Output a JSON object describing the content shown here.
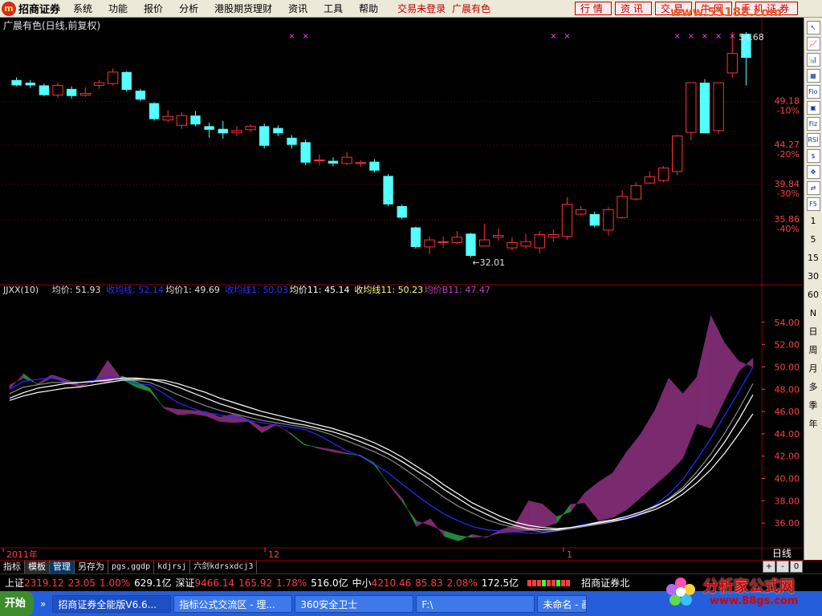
{
  "menubar": {
    "logo": "招商证券",
    "items": [
      "系统",
      "功能",
      "报价",
      "分析",
      "港股期货理财",
      "资讯",
      "工具",
      "帮助"
    ],
    "status": "交易未登录",
    "symbol": "广晨有色",
    "buttons": [
      "行情",
      "资讯",
      "交易",
      "牛网",
      "手机证券"
    ],
    "watermark": "www.55188.com"
  },
  "chart_title": "广晨有色(日线,前复权)",
  "indicator_legend": [
    {
      "text": "JJXX(10)",
      "color": "#e0e0e0"
    },
    {
      "text": "均价: 51.93",
      "color": "#e0e0e0"
    },
    {
      "text": "收均线: 52.14",
      "color": "#3030ff"
    },
    {
      "text": "均价1: 49.69",
      "color": "#e0e0e0"
    },
    {
      "text": "收均线1: 50.03",
      "color": "#3030ff"
    },
    {
      "text": "均价11: 45.14",
      "color": "#ffffff"
    },
    {
      "text": "收均线11: 50.23",
      "color": "#ffff80"
    },
    {
      "text": "均价B11: 47.47",
      "color": "#c040c0"
    }
  ],
  "chart_data": [
    {
      "type": "candlestick",
      "title": "广晨有色(日线,前复权)",
      "price_range": [
        29.0,
        57.0
      ],
      "y_labels": [
        {
          "price": "49.18",
          "pct": "-10%"
        },
        {
          "price": "44.27",
          "pct": "-20%"
        },
        {
          "price": "39.84",
          "pct": "-30%"
        },
        {
          "price": "35.86",
          "pct": "-40%"
        }
      ],
      "annotations": {
        "low_label": "←32.01",
        "high_label": "54.68"
      },
      "colors": {
        "up": "#ff3232",
        "down": "#54ffff"
      },
      "candles": [
        {
          "o": 51.6,
          "c": 51.0,
          "h": 51.9,
          "l": 50.9
        },
        {
          "o": 51.3,
          "c": 51.0,
          "h": 51.6,
          "l": 50.7
        },
        {
          "o": 51.0,
          "c": 49.9,
          "h": 51.2,
          "l": 49.8
        },
        {
          "o": 49.9,
          "c": 51.0,
          "h": 51.3,
          "l": 49.6
        },
        {
          "o": 50.6,
          "c": 49.8,
          "h": 50.9,
          "l": 49.5
        },
        {
          "o": 49.9,
          "c": 50.1,
          "h": 50.8,
          "l": 49.7
        },
        {
          "o": 51.0,
          "c": 51.3,
          "h": 51.6,
          "l": 50.6
        },
        {
          "o": 51.2,
          "c": 52.5,
          "h": 52.9,
          "l": 51.0
        },
        {
          "o": 52.5,
          "c": 50.5,
          "h": 52.6,
          "l": 50.3
        },
        {
          "o": 50.4,
          "c": 49.4,
          "h": 50.6,
          "l": 49.2
        },
        {
          "o": 49.0,
          "c": 47.2,
          "h": 49.1,
          "l": 47.0
        },
        {
          "o": 47.1,
          "c": 47.5,
          "h": 48.2,
          "l": 46.9
        },
        {
          "o": 46.5,
          "c": 47.6,
          "h": 48.0,
          "l": 46.1
        },
        {
          "o": 47.6,
          "c": 46.6,
          "h": 48.1,
          "l": 46.4
        },
        {
          "o": 46.4,
          "c": 46.0,
          "h": 46.8,
          "l": 45.1
        },
        {
          "o": 46.1,
          "c": 45.6,
          "h": 47.0,
          "l": 45.0
        },
        {
          "o": 45.7,
          "c": 45.9,
          "h": 46.4,
          "l": 45.3
        },
        {
          "o": 46.0,
          "c": 46.4,
          "h": 46.6,
          "l": 45.8
        },
        {
          "o": 46.4,
          "c": 44.2,
          "h": 46.7,
          "l": 43.9
        },
        {
          "o": 46.2,
          "c": 45.6,
          "h": 46.5,
          "l": 45.3
        },
        {
          "o": 45.1,
          "c": 44.3,
          "h": 45.4,
          "l": 43.9
        },
        {
          "o": 44.6,
          "c": 42.3,
          "h": 44.9,
          "l": 42.0
        },
        {
          "o": 42.5,
          "c": 42.6,
          "h": 43.2,
          "l": 42.0
        },
        {
          "o": 42.5,
          "c": 42.2,
          "h": 42.9,
          "l": 41.9
        },
        {
          "o": 42.2,
          "c": 42.9,
          "h": 43.5,
          "l": 42.0
        },
        {
          "o": 42.2,
          "c": 42.3,
          "h": 42.6,
          "l": 41.8
        },
        {
          "o": 42.4,
          "c": 41.4,
          "h": 42.7,
          "l": 41.2
        },
        {
          "o": 40.8,
          "c": 37.6,
          "h": 41.0,
          "l": 37.4
        },
        {
          "o": 37.4,
          "c": 36.1,
          "h": 37.6,
          "l": 35.9
        },
        {
          "o": 35.0,
          "c": 32.8,
          "h": 35.1,
          "l": 32.6
        },
        {
          "o": 32.8,
          "c": 33.6,
          "h": 34.0,
          "l": 32.0
        },
        {
          "o": 33.4,
          "c": 33.4,
          "h": 34.0,
          "l": 32.7
        },
        {
          "o": 33.3,
          "c": 33.9,
          "h": 34.6,
          "l": 33.1
        },
        {
          "o": 34.3,
          "c": 31.8,
          "h": 34.4,
          "l": 31.6
        },
        {
          "o": 32.9,
          "c": 33.6,
          "h": 35.4,
          "l": 32.9
        },
        {
          "o": 33.9,
          "c": 34.1,
          "h": 34.9,
          "l": 33.5
        },
        {
          "o": 32.7,
          "c": 33.3,
          "h": 33.9,
          "l": 32.4
        },
        {
          "o": 32.9,
          "c": 33.4,
          "h": 34.3,
          "l": 32.6
        },
        {
          "o": 32.7,
          "c": 34.2,
          "h": 34.6,
          "l": 32.1
        },
        {
          "o": 33.9,
          "c": 34.2,
          "h": 34.8,
          "l": 33.4
        },
        {
          "o": 34.0,
          "c": 37.6,
          "h": 38.4,
          "l": 33.6
        },
        {
          "o": 36.5,
          "c": 37.0,
          "h": 37.4,
          "l": 36.4
        },
        {
          "o": 36.5,
          "c": 35.2,
          "h": 36.8,
          "l": 35.0
        },
        {
          "o": 34.7,
          "c": 37.0,
          "h": 37.3,
          "l": 34.1
        },
        {
          "o": 36.1,
          "c": 38.5,
          "h": 39.2,
          "l": 36.0
        },
        {
          "o": 38.2,
          "c": 39.7,
          "h": 40.1,
          "l": 38.0
        },
        {
          "o": 40.0,
          "c": 40.7,
          "h": 41.3,
          "l": 39.9
        },
        {
          "o": 40.3,
          "c": 41.7,
          "h": 41.9,
          "l": 40.1
        },
        {
          "o": 41.3,
          "c": 45.3,
          "h": 45.4,
          "l": 40.9
        },
        {
          "o": 45.7,
          "c": 51.3,
          "h": 51.3,
          "l": 44.8
        },
        {
          "o": 51.3,
          "c": 45.6,
          "h": 51.7,
          "l": 45.6
        },
        {
          "o": 45.9,
          "c": 51.3,
          "h": 51.3,
          "l": 45.5
        },
        {
          "o": 52.4,
          "c": 54.6,
          "h": 57.0,
          "l": 51.9
        },
        {
          "o": 56.8,
          "c": 54.1,
          "h": 57.0,
          "l": 51.0
        }
      ]
    },
    {
      "type": "line",
      "title": "JJXX(10)",
      "ylim": [
        34.0,
        56.0
      ],
      "y_ticks": [
        "54.00",
        "52.00",
        "50.00",
        "48.00",
        "46.00",
        "44.00",
        "42.00",
        "40.00",
        "38.00",
        "36.00"
      ],
      "x_labels": [
        "2011年",
        "12",
        "1"
      ],
      "series": [
        {
          "name": "均价",
          "color": "#2a2aff",
          "values": [
            48.0,
            48.7,
            48.9,
            49.0,
            48.7,
            48.6,
            48.8,
            49.2,
            48.9,
            48.5,
            48.4,
            47.6,
            46.8,
            46.3,
            45.9,
            45.7,
            45.5,
            45.2,
            45.0,
            44.8,
            44.6,
            44.4,
            43.9,
            43.2,
            42.5,
            42.0,
            41.3,
            40.5,
            39.5,
            38.5,
            37.6,
            36.8,
            36.2,
            35.7,
            35.4,
            35.3,
            35.2,
            35.1,
            35.1,
            35.3,
            35.6,
            35.9,
            36.1,
            36.2,
            36.5,
            36.9,
            37.6,
            38.6,
            39.9,
            41.7,
            43.6,
            45.7,
            47.8,
            50.0
          ]
        },
        {
          "name": "收均线",
          "color": "#1e9a3a",
          "values": [
            48.0,
            49.4,
            48.4,
            49.0,
            48.6,
            48.2,
            48.7,
            48.6,
            49.2,
            48.7,
            48.1,
            46.3,
            45.7,
            45.8,
            45.6,
            45.1,
            45.0,
            45.1,
            44.1,
            44.8,
            44.1,
            43.1,
            42.7,
            42.4,
            42.2,
            42.1,
            41.4,
            39.5,
            37.9,
            36.2,
            35.8,
            35.3,
            34.9,
            34.7,
            34.8,
            35.1,
            35.2,
            35.3,
            35.6,
            36.0,
            37.7,
            37.8,
            36.2,
            36.5,
            37.2,
            38.3,
            39.4,
            40.5,
            41.8,
            44.9,
            44.5,
            47.1,
            49.6,
            50.8
          ]
        },
        {
          "name": "均价1",
          "color": "#8a8a8a",
          "values": [
            47.6,
            48.2,
            48.4,
            48.6,
            48.6,
            48.6,
            48.7,
            48.9,
            48.9,
            48.8,
            48.6,
            48.1,
            47.5,
            47.0,
            46.5,
            46.1,
            45.8,
            45.5,
            45.2,
            45.0,
            44.8,
            44.6,
            44.3,
            43.9,
            43.4,
            42.9,
            42.4,
            41.8,
            41.0,
            40.1,
            39.2,
            38.3,
            37.5,
            36.9,
            36.3,
            35.9,
            35.6,
            35.4,
            35.2,
            35.3,
            35.5,
            35.7,
            35.9,
            36.1,
            36.4,
            36.8,
            37.4,
            38.2,
            39.2,
            40.6,
            42.2,
            44.1,
            46.2,
            48.5
          ]
        },
        {
          "name": "均价11",
          "color": "#ffffff",
          "values": [
            47.2,
            47.7,
            48.1,
            48.3,
            48.5,
            48.6,
            48.7,
            48.8,
            49.0,
            49.0,
            48.9,
            48.6,
            48.2,
            47.7,
            47.2,
            46.7,
            46.3,
            45.9,
            45.6,
            45.3,
            45.0,
            44.8,
            44.5,
            44.2,
            43.8,
            43.3,
            42.8,
            42.2,
            41.5,
            40.7,
            39.9,
            39.0,
            38.2,
            37.4,
            36.8,
            36.2,
            35.8,
            35.5,
            35.4,
            35.4,
            35.6,
            35.8,
            36.1,
            36.3,
            36.6,
            37.0,
            37.5,
            38.1,
            39.0,
            40.2,
            41.6,
            43.3,
            45.3,
            47.5
          ]
        },
        {
          "name": "收均线11",
          "color": "#ffffff",
          "values": [
            47.0,
            47.4,
            47.7,
            47.9,
            48.1,
            48.2,
            48.4,
            48.6,
            48.8,
            48.9,
            48.9,
            48.8,
            48.5,
            48.1,
            47.7,
            47.2,
            46.8,
            46.4,
            46.0,
            45.7,
            45.4,
            45.1,
            44.8,
            44.5,
            44.1,
            43.7,
            43.2,
            42.6,
            41.9,
            41.1,
            40.3,
            39.4,
            38.6,
            37.8,
            37.2,
            36.6,
            36.1,
            35.8,
            35.6,
            35.5,
            35.6,
            35.8,
            36.0,
            36.2,
            36.4,
            36.8,
            37.2,
            37.8,
            38.6,
            39.6,
            40.8,
            42.3,
            44.0,
            45.8
          ]
        },
        {
          "name": "均价B11",
          "color": "#8c2f7a",
          "values": [
            48.4,
            49.0,
            48.5,
            49.3,
            48.9,
            48.4,
            48.6,
            50.6,
            48.9,
            48.2,
            47.8,
            46.4,
            46.2,
            46.1,
            46.0,
            45.5,
            45.8,
            45.3,
            44.6,
            44.9,
            44.0,
            43.0,
            42.8,
            42.6,
            42.3,
            42.0,
            41.2,
            39.6,
            38.2,
            35.7,
            36.4,
            34.8,
            34.4,
            35.0,
            34.7,
            35.4,
            35.8,
            38.0,
            37.7,
            36.6,
            37.0,
            38.7,
            39.7,
            40.5,
            42.4,
            44.0,
            46.1,
            49.0,
            47.6,
            49.1,
            54.6,
            52.1,
            50.5,
            50.0
          ]
        }
      ]
    }
  ],
  "bottom_tabs": [
    "指标",
    "模板",
    "管理",
    "另存为",
    "pgs,ggdp",
    "kdjrsj",
    "六剑kdrsxdcj3"
  ],
  "period": "日线",
  "ctrl_buttons": [
    "+",
    "-",
    "0"
  ],
  "ticker": {
    "sh": {
      "name": "上证",
      "value": "2319.12",
      "change": "23.05",
      "pct": "1.00%",
      "amount": "629.1亿"
    },
    "sz": {
      "name": "深证",
      "value": "9466.14",
      "change": "165.92",
      "pct": "1.78%",
      "amount": "516.0亿"
    },
    "zx": {
      "name": "中小",
      "value": "4210.46",
      "change": "85.83",
      "pct": "2.08%",
      "amount": "172.5亿"
    },
    "broker": "招商证券北"
  },
  "toolbar": [
    "↖",
    "📈",
    "📊",
    "▦",
    "Fio",
    "▣",
    "Fiz",
    "RSI",
    "$",
    "✥",
    "⇄",
    "F5",
    "1",
    "5",
    "15",
    "30",
    "60",
    "N",
    "日",
    "周",
    "月",
    "多",
    "季",
    "年"
  ],
  "taskbar": {
    "start": "开始",
    "tasks": [
      "招商证券全能版V6.6...",
      "指标公式交流区 - 理...",
      "360安全卫士",
      "F:\\",
      "未命名 - 画"
    ]
  },
  "brand": {
    "name": "分析家公式网",
    "url": "www.88gs.com"
  }
}
